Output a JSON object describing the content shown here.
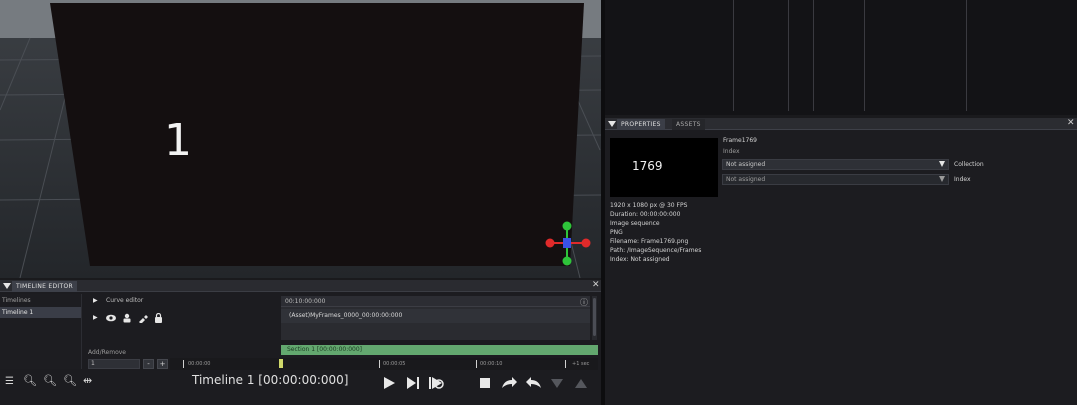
{
  "viewport": {
    "frame_number": "1"
  },
  "properties": {
    "tabs": [
      {
        "label": "PROPERTIES",
        "active": true
      },
      {
        "label": "ASSETS",
        "active": false
      }
    ],
    "asset_name": "Frame1769",
    "thumbnail_text": "1769",
    "index_label": "Index",
    "collection_value": "Not assigned",
    "collection_label": "Collection",
    "index_value": "Not assigned",
    "index_side_label": "Index",
    "info_lines": [
      "1920 x 1080 px @ 30 FPS",
      "Duration: 00:00:00:000",
      "Image sequence",
      "PNG",
      "Filename: Frame1769.png",
      "Path: /ImageSequence/Frames",
      "Index: Not assigned"
    ]
  },
  "timeline": {
    "tab_label": "TIMELINE EDITOR",
    "timelines_label": "Timelines",
    "timeline_item": "Timeline 1",
    "curve_editor_label": "Curve editor",
    "time_header": "00:10:00:000",
    "track_label": "(Asset)MyFrames_0000_00:00:00:000",
    "section_label": "Section 1 [00:00:00:000]",
    "add_remove_label": "Add/Remove",
    "add_value": "1",
    "ruler_labels": [
      "00:00:00",
      "00:00:05",
      "00:00:10",
      "+1 sec"
    ],
    "title": "Timeline 1 [00:00:00:000]"
  },
  "colors": {
    "accent_blue": "#3b3e47",
    "section_green": "#63a86f",
    "gizmo_red": "#e02a2a",
    "gizmo_green": "#2ec43a",
    "gizmo_blue": "#3a52e6"
  }
}
